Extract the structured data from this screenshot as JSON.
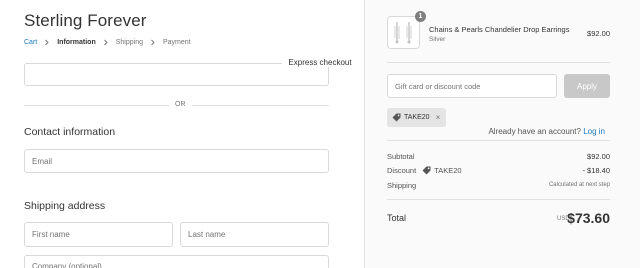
{
  "store": {
    "name": "Sterling Forever"
  },
  "breadcrumb": {
    "items": [
      {
        "label": "Cart"
      },
      {
        "label": "Information"
      },
      {
        "label": "Shipping"
      },
      {
        "label": "Payment"
      }
    ]
  },
  "express": {
    "label": "Express checkout",
    "or": "OR"
  },
  "contact": {
    "title": "Contact information",
    "account_prompt": "Already have an account?",
    "login_label": "Log in",
    "email_placeholder": "Email"
  },
  "shipping": {
    "title": "Shipping address",
    "first_name_placeholder": "First name",
    "last_name_placeholder": "Last name",
    "company_placeholder": "Company (optional)"
  },
  "cart": {
    "product": {
      "name": "Chains & Pearls Chandelier Drop Earrings",
      "variant": "Silver",
      "price": "$92.00",
      "quantity": "1",
      "image_icon": "earrings-thumbnail"
    },
    "gift_placeholder": "Gift card or discount code",
    "apply_label": "Apply",
    "applied_code": "TAKE20",
    "subtotal_label": "Subtotal",
    "subtotal_value": "$92.00",
    "discount_label": "Discount",
    "discount_code": "TAKE20",
    "discount_value": "- $18.40",
    "shipping_label": "Shipping",
    "shipping_value": "Calculated at next step",
    "total_label": "Total",
    "total_currency": "USD",
    "total_value": "$73.60"
  },
  "colors": {
    "link": "#197bbd",
    "apply_disabled": "#c8c8c8",
    "badge": "#7f7f7f",
    "sidebar_bg": "#fafafa"
  }
}
